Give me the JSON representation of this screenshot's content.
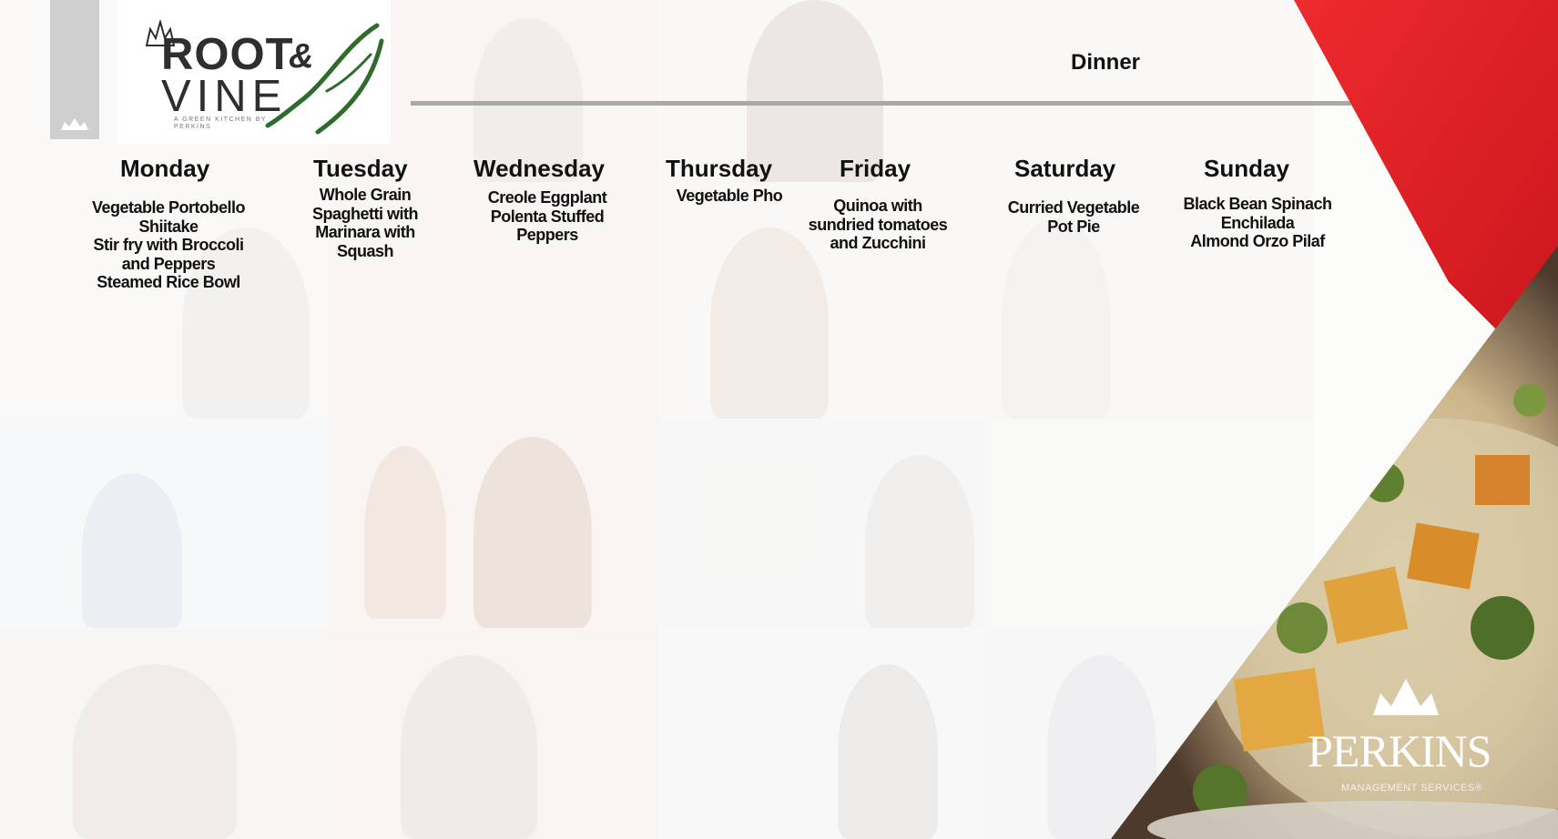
{
  "meal_label": "Dinner",
  "logo": {
    "word1": "ROOT",
    "amp": "&",
    "word2": "VINE",
    "tagline": "A GREEN KITCHEN BY PERKINS"
  },
  "brand": {
    "name": "PERKINS",
    "sub": "MANAGEMENT SERVICES®"
  },
  "days": [
    {
      "name": "Monday",
      "items": [
        "Vegetable Portobello",
        "Shiitake",
        "Stir fry with Broccoli",
        "and Peppers",
        "Steamed Rice Bowl"
      ]
    },
    {
      "name": "Tuesday",
      "items": [
        "Whole Grain",
        "Spaghetti with",
        "Marinara with",
        "Squash"
      ]
    },
    {
      "name": "Wednesday",
      "items": [
        "Creole Eggplant",
        "Polenta Stuffed",
        "Peppers"
      ]
    },
    {
      "name": "Thursday",
      "items": [
        "Vegetable Pho"
      ]
    },
    {
      "name": "Friday",
      "items": [
        "Quinoa with",
        "sundried tomatoes",
        "and Zucchini"
      ]
    },
    {
      "name": "Saturday",
      "items": [
        "Curried Vegetable",
        "Pot Pie"
      ]
    },
    {
      "name": "Sunday",
      "items": [
        "Black Bean Spinach",
        "Enchilada",
        "Almond Orzo Pilaf"
      ]
    }
  ],
  "colors": {
    "accent_red": "#e31e24",
    "logo_green": "#2f6b2a",
    "rule_gray": "#a9a9a9"
  }
}
